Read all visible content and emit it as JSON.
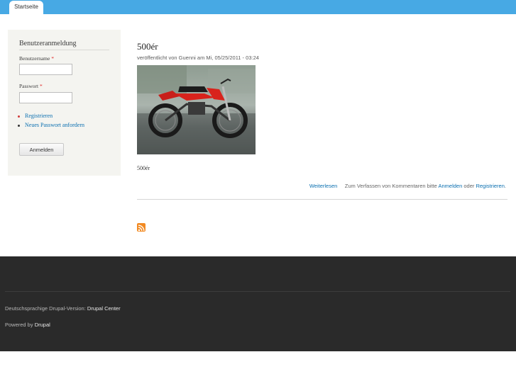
{
  "nav": {
    "tabs": [
      {
        "label": "Startseite"
      }
    ]
  },
  "login": {
    "title": "Benutzeranmeldung",
    "username_label": "Benutzername",
    "password_label": "Passwort",
    "required_mark": "*",
    "username_value": "",
    "password_value": "",
    "links": [
      {
        "label": "Registrieren"
      },
      {
        "label": "Neues Passwort anfordern"
      }
    ],
    "submit_label": "Anmelden"
  },
  "node": {
    "title": "500ér",
    "submitted": "veröffentlicht von Guenni am Mi, 05/25/2011 - 03:24",
    "body": "500ér",
    "read_more": "Weiterlesen",
    "comment_prefix": "Zum Verfassen von Kommentaren bitte",
    "login_link": "Anmelden",
    "or_text": "oder",
    "register_link": "Registrieren",
    "period": "."
  },
  "footer": {
    "version_label": "Deutschsprachige Drupal-Version:",
    "version_link": "Drupal Center",
    "powered_label": "Powered by",
    "powered_link": "Drupal"
  },
  "colors": {
    "top_bar": "#47a9e4",
    "footer_bg": "#2a2a2a",
    "link": "#0a6fb0",
    "required": "#e02020"
  },
  "icons": {
    "feed": "rss-feed-icon"
  }
}
